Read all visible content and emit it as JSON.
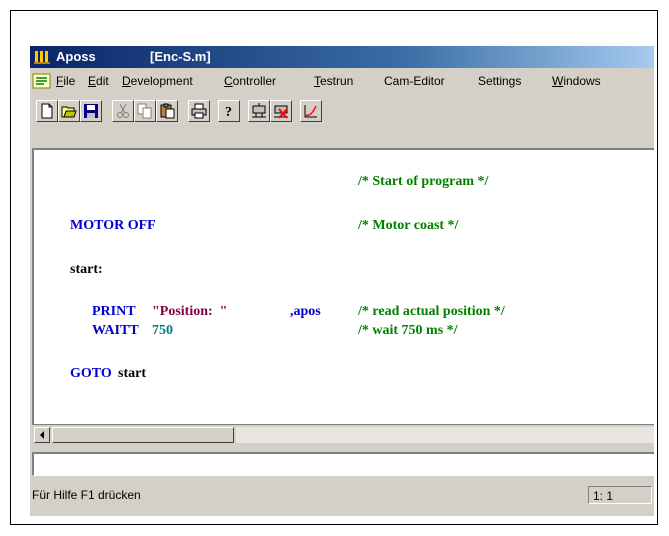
{
  "window": {
    "app_title": "Aposs",
    "document_title": "[Enc-S.m]"
  },
  "menu": {
    "items": [
      {
        "label": "File",
        "accel": "F"
      },
      {
        "label": "Edit",
        "accel": "E"
      },
      {
        "label": "Development",
        "accel": "D"
      },
      {
        "label": "Controller",
        "accel": "C"
      },
      {
        "label": "Testrun",
        "accel": "T"
      },
      {
        "label": "Cam-Editor",
        "accel": ""
      },
      {
        "label": "Settings",
        "accel": ""
      },
      {
        "label": "Windows",
        "accel": "W"
      }
    ]
  },
  "toolbar": {
    "buttons": [
      "new-icon",
      "open-icon",
      "save-icon",
      "cut-icon",
      "copy-icon",
      "paste-icon",
      "print-icon",
      "help-icon",
      "motor-icon",
      "motor-stop-icon",
      "curve-icon"
    ]
  },
  "editor": {
    "comment_start": "/* Start of program */",
    "motor_kw": "MOTOR OFF",
    "motor_comment": "/* Motor coast */",
    "label_start": "start:",
    "print_kw": "PRINT",
    "print_string": "\"Position:  \"",
    "print_var": ",apos",
    "print_comment": "/* read actual position */",
    "waitt_kw": "WAITT",
    "waitt_num": "750",
    "waitt_comment": "/* wait 750 ms */",
    "goto_kw": "GOTO",
    "goto_target": "start"
  },
  "status": {
    "help_text": "Für Hilfe F1 drücken",
    "cursor_pos": "1: 1"
  },
  "colors": {
    "keyword": "#0000cc",
    "comment": "#008000",
    "string": "#800040",
    "number": "#008080",
    "titlebar_start": "#0a246a"
  }
}
